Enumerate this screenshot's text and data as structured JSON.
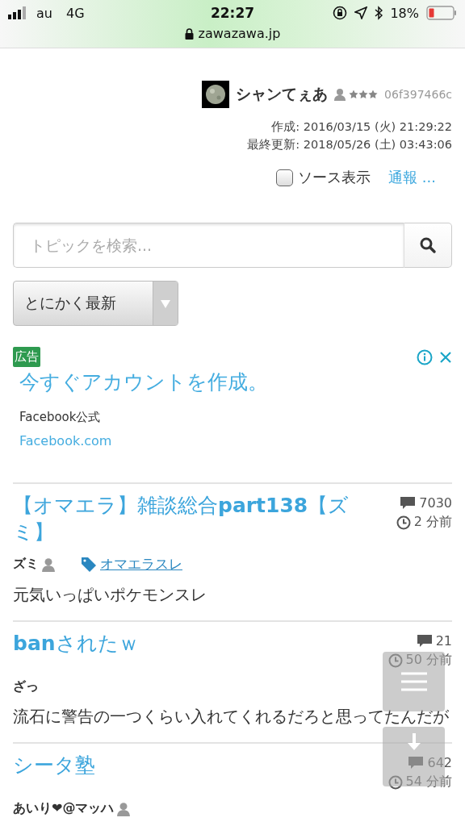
{
  "status_bar": {
    "carrier": "au",
    "network": "4G",
    "time": "22:27",
    "battery": "18%",
    "url": "zawazawa.jp"
  },
  "author": {
    "name": "シャンてぇあ",
    "stars": 3,
    "id": "06f397466c",
    "created": "作成: 2016/03/15 (火) 21:29:22",
    "updated": "最終更新: 2018/05/26 (土) 03:43:06"
  },
  "source_toggle": {
    "label": "ソース表示",
    "checked": false
  },
  "report_link": "通報 ...",
  "search": {
    "placeholder": "トピックを検索..."
  },
  "sort_select": {
    "value": "とにかく最新"
  },
  "ad": {
    "badge": "広告",
    "headline": "今すぐアカウントを作成。",
    "advertiser": "Facebook公式",
    "url": "Facebook.com"
  },
  "topics": [
    {
      "title": "【オマエラ】雑談総合**part138**【ズミ】",
      "comments": "7030",
      "time": "2 分前",
      "author": "ズミ",
      "user_icon": true,
      "tag": "オマエラスレ",
      "body": "元気いっぱいポケモンスレ"
    },
    {
      "title": "**ban**されたｗ",
      "comments": "21",
      "time": "50 分前",
      "author": "ざっ",
      "user_icon": false,
      "body": "流石に警告の一つくらい入れてくれるだろと思ってたんだが"
    },
    {
      "title": "シータ塾",
      "comments": "642",
      "time": "54 分前",
      "author": "あいり❤@マッハ",
      "user_icon": true
    }
  ]
}
